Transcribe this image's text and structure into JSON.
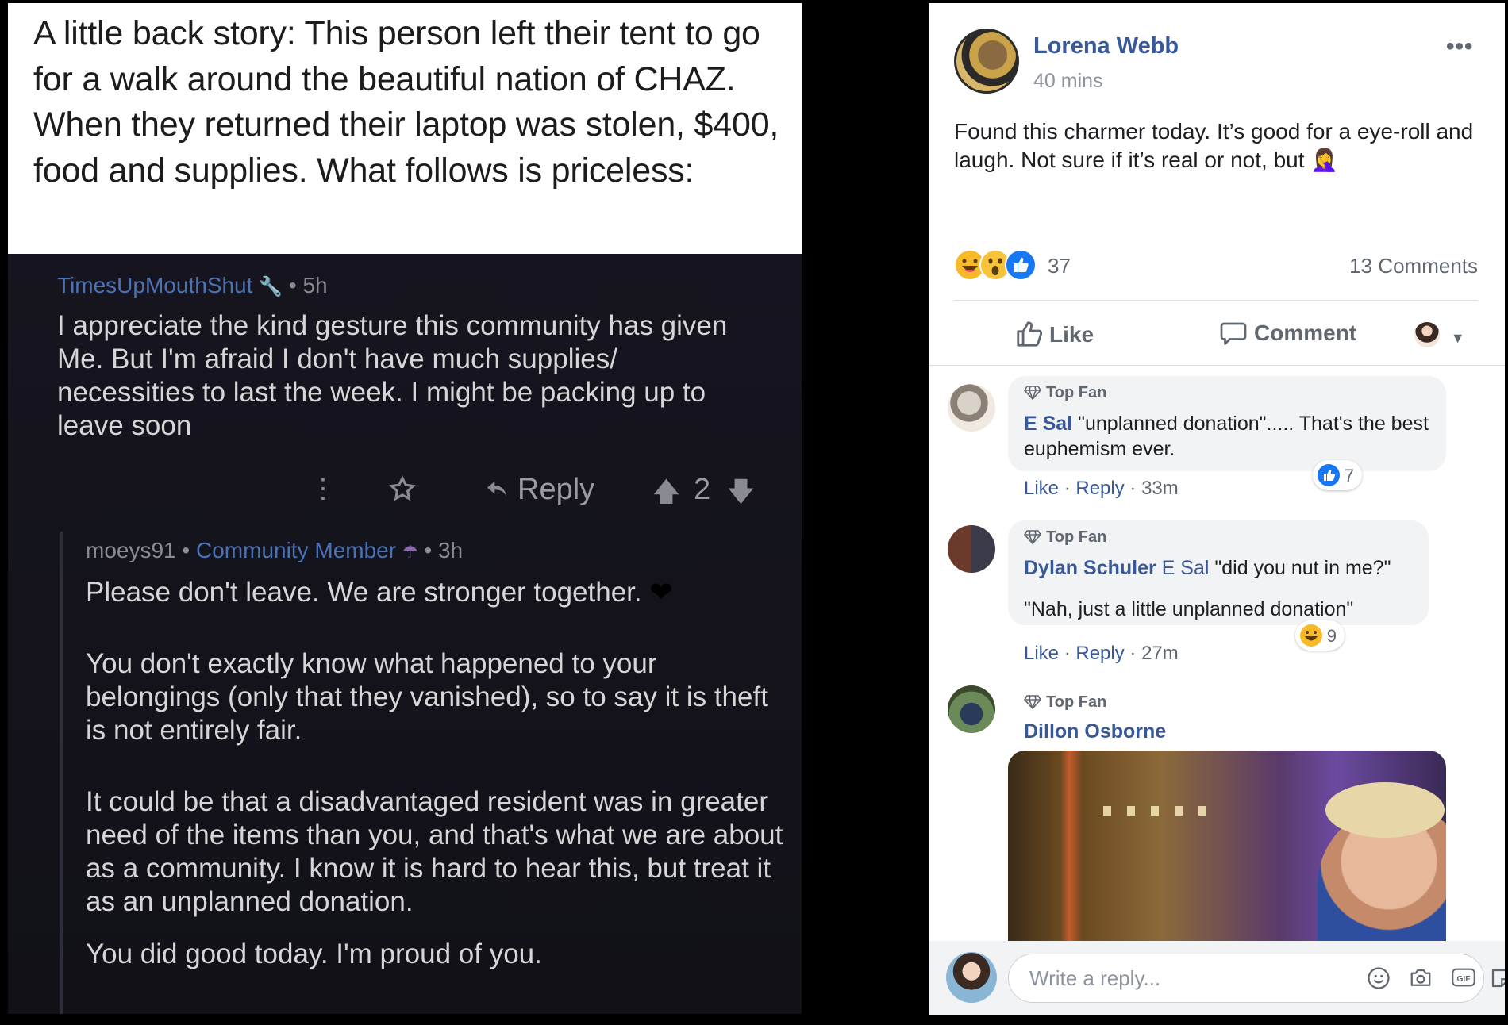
{
  "left": {
    "backstory": "A little back story: This person left their tent to go for a walk around the beautiful nation of CHAZ. When they returned their laptop was stolen, $400, food and supplies. What follows is priceless:",
    "comment1": {
      "author": "TimesUpMouthShut",
      "time": "• 5h",
      "text": "I appreciate the kind gesture this community has given Me. But I'm afraid I don't have much supplies/ necessities to last the week. I might be packing up to leave soon",
      "reply_label": "Reply",
      "votes": "2"
    },
    "comment2": {
      "author": "moeys91",
      "sep": "•",
      "flair": "Community Member",
      "time": "• 3h",
      "p1": "Please don't leave. We are stronger together.",
      "p2": "You don't exactly know what happened to your belongings (only that they vanished), so to say it is theft is not entirely fair.",
      "p3": "It could be that a disadvantaged resident was in greater need of the items than you, and that's what we are about as a community. I know it is hard to hear this, but treat it as an unplanned donation.",
      "p4": "You did good today. I'm proud of you."
    }
  },
  "post": {
    "author": "Lorena Webb",
    "time": "40 mins",
    "text": "Found this charmer today. It’s good for a eye-roll and laugh. Not sure if it’s real or not, but 🤦‍♀️",
    "reactions": {
      "icons": [
        "haha-icon",
        "wow-icon",
        "like-icon"
      ],
      "count": "37"
    },
    "comments_count": "13 Comments",
    "actions": {
      "like": "Like",
      "comment": "Comment"
    }
  },
  "comments": [
    {
      "badge": "Top Fan",
      "name": "E Sal",
      "text": "\"unplanned donation\"..... That's the best euphemism ever.",
      "like": "Like",
      "reply": "Reply",
      "time": "33m",
      "reaction": {
        "type": "like",
        "count": "7"
      }
    },
    {
      "badge": "Top Fan",
      "name": "Dylan Schuler",
      "tag": "E Sal",
      "text1": "\"did you nut in me?\"",
      "text2": "\"Nah, just a little unplanned donation\"",
      "like": "Like",
      "reply": "Reply",
      "time": "27m",
      "reaction": {
        "type": "haha",
        "count": "9"
      }
    },
    {
      "badge": "Top Fan",
      "name": "Dillon Osborne"
    }
  ],
  "reply_box": {
    "placeholder": "Write a reply..."
  },
  "colors": {
    "fb_blue": "#385898",
    "like_blue": "#1877f2",
    "haha_yellow": "#f7b928",
    "dark_bg": "#14141c"
  }
}
